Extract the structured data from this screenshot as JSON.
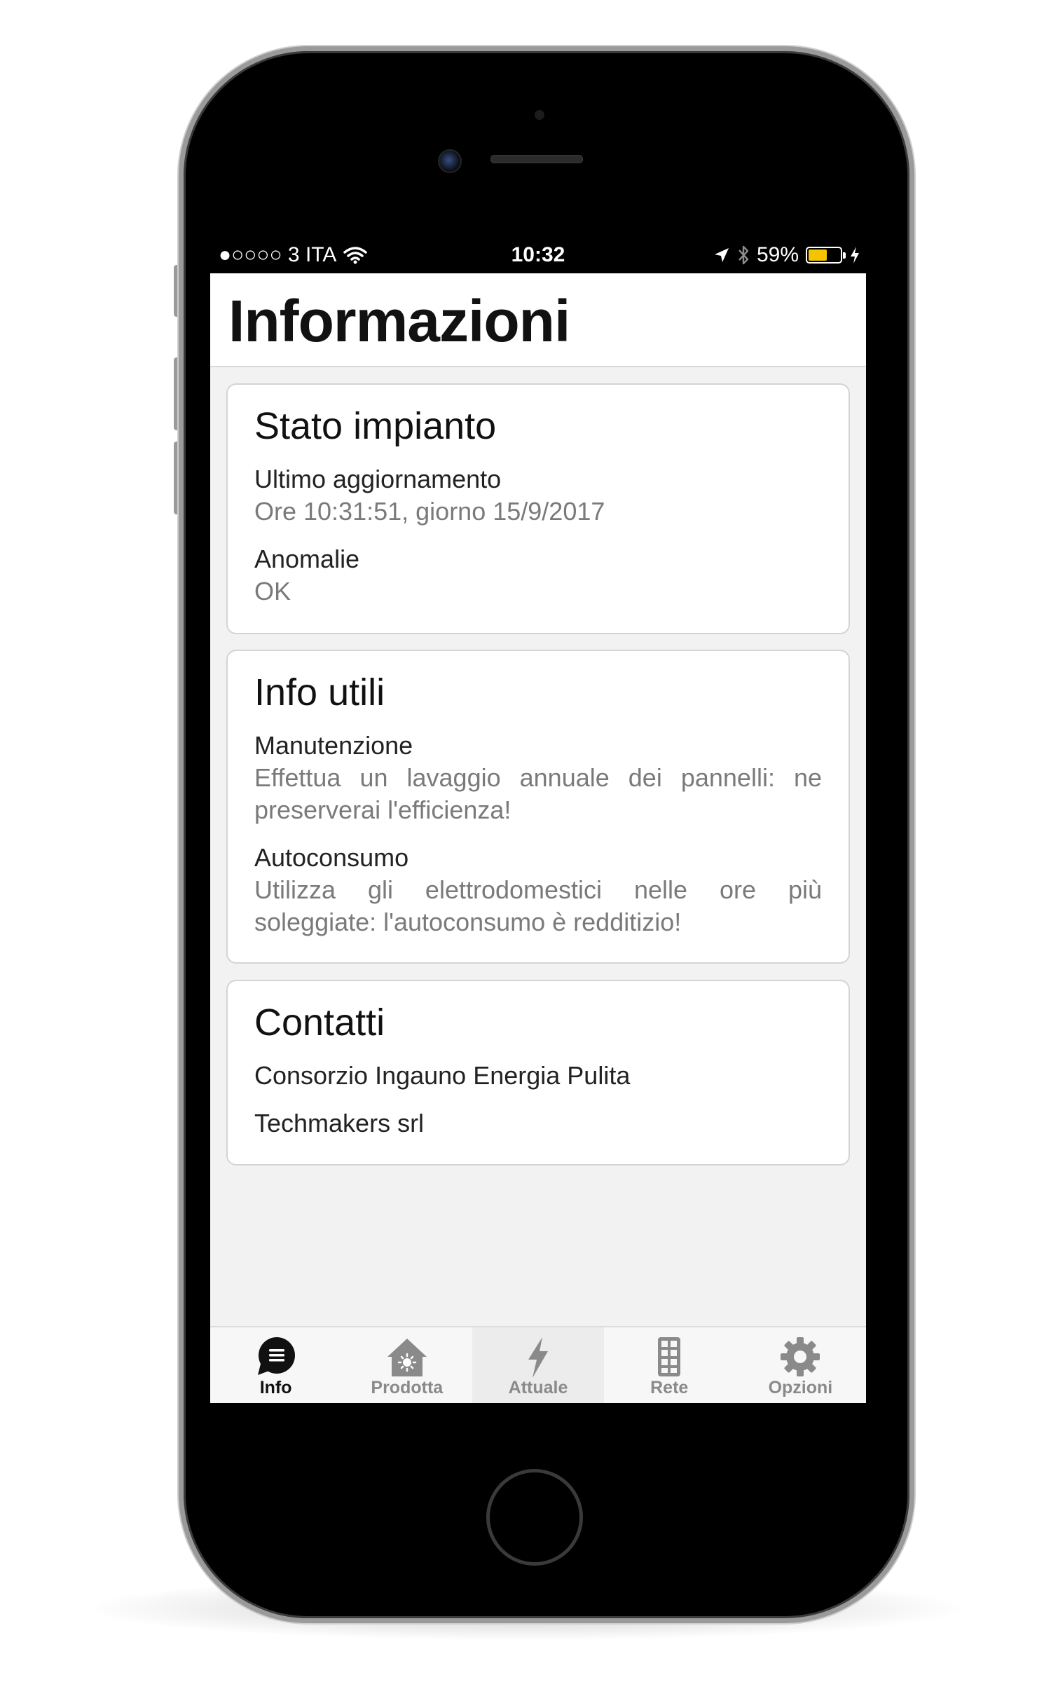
{
  "status_bar": {
    "carrier": "●○○○○ 3 ITA",
    "time": "10:32",
    "battery_percent": "59%",
    "battery_level": 0.59,
    "battery_color": "#f5c400"
  },
  "header": {
    "title": "Informazioni"
  },
  "cards": {
    "stato": {
      "title": "Stato impianto",
      "items": [
        {
          "label": "Ultimo aggiornamento",
          "value": "Ore 10:31:51, giorno 15/9/2017"
        },
        {
          "label": "Anomalie",
          "value": "OK"
        }
      ]
    },
    "info": {
      "title": "Info utili",
      "items": [
        {
          "label": "Manutenzione",
          "value": "Effettua un lavaggio annuale dei pannelli: ne preserverai l'efficienza!"
        },
        {
          "label": "Autoconsumo",
          "value": "Utilizza gli elettrodomestici nelle ore più soleggiate: l'autoconsumo è redditizio!"
        }
      ]
    },
    "contatti": {
      "title": "Contatti",
      "items": [
        "Consorzio Ingauno Energia Pulita",
        "Techmakers srl"
      ]
    }
  },
  "tabbar": {
    "active": "Info",
    "tabs": [
      {
        "label": "Info",
        "icon": "chat-bubble-list-icon"
      },
      {
        "label": "Prodotta",
        "icon": "house-sun-icon"
      },
      {
        "label": "Attuale",
        "icon": "lightning-bolt-icon"
      },
      {
        "label": "Rete",
        "icon": "solar-panel-icon"
      },
      {
        "label": "Opzioni",
        "icon": "gear-icon"
      }
    ]
  },
  "colors": {
    "tab_active": "#111111",
    "tab_inactive": "#8a8a8a",
    "screen_bg": "#f2f2f2"
  }
}
